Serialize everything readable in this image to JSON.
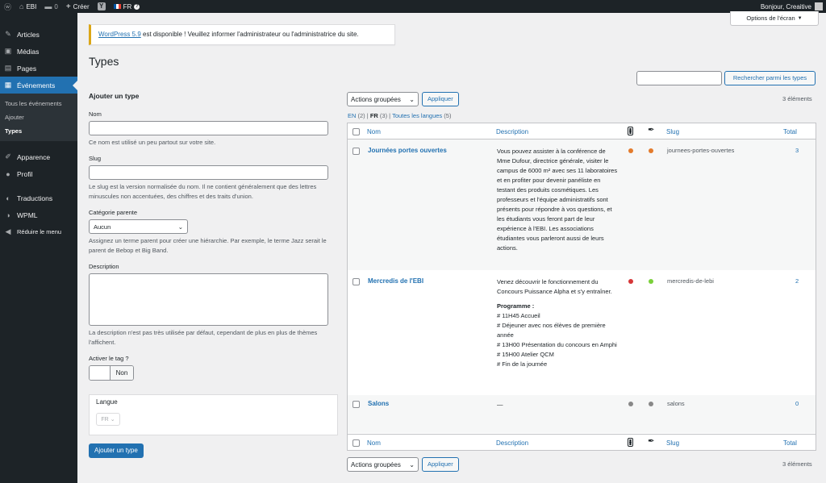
{
  "adminbar": {
    "site_name": "EBI",
    "comments_count": "0",
    "new_label": "Créer",
    "language": "FR",
    "greeting": "Bonjour, Creaitive"
  },
  "sidebar": {
    "items": [
      {
        "label": "Articles",
        "icon": "pin-icon"
      },
      {
        "label": "Médias",
        "icon": "media-icon"
      },
      {
        "label": "Pages",
        "icon": "pages-icon"
      },
      {
        "label": "Événements",
        "icon": "calendar-icon"
      },
      {
        "label": "Apparence",
        "icon": "brush-icon"
      },
      {
        "label": "Profil",
        "icon": "user-icon"
      },
      {
        "label": "Traductions",
        "icon": "translation-icon"
      },
      {
        "label": "WPML",
        "icon": "wpml-icon"
      },
      {
        "label": "Réduire le menu",
        "icon": "collapse-icon"
      }
    ],
    "submenu": [
      "Tous les événements",
      "Ajouter",
      "Types"
    ]
  },
  "screen_options": "Options de l'écran",
  "notice": {
    "link": "WordPress 5.9",
    "text": " est disponible ! Veuillez informer l'administrateur ou l'administratrice du site."
  },
  "page_title": "Types",
  "search_button": "Rechercher parmi les types",
  "form": {
    "heading": "Ajouter un type",
    "name_label": "Nom",
    "name_desc": "Ce nom est utilisé un peu partout sur votre site.",
    "slug_label": "Slug",
    "slug_desc": "Le slug est la version normalisée du nom. Il ne contient généralement que des lettres minuscules non accentuées, des chiffres et des traits d'union.",
    "parent_label": "Catégorie parente",
    "parent_value": "Aucun",
    "parent_desc": "Assignez un terme parent pour créer une hiérarchie. Par exemple, le terme Jazz serait le parent de Bebop et Big Band.",
    "description_label": "Description",
    "description_desc": "La description n'est pas très utilisée par défaut, cependant de plus en plus de thèmes l'affichent.",
    "tag_label": "Activer le tag ?",
    "tag_value": "Non",
    "language_label": "Langue",
    "language_value": "FR",
    "submit": "Ajouter un type"
  },
  "list": {
    "bulk_label": "Actions groupées",
    "apply": "Appliquer",
    "count": "3 éléments",
    "lang_filter": {
      "en": "EN",
      "en_count": "(2)",
      "fr": "FR",
      "fr_count": "(3)",
      "all": "Toutes les langues",
      "all_count": "(5)"
    },
    "columns": {
      "name": "Nom",
      "description": "Description",
      "slug": "Slug",
      "total": "Total"
    },
    "rows": [
      {
        "name": "Journées portes ouvertes",
        "description": "Vous pouvez assister à la conférence de Mme Dufour, directrice générale, visiter le campus de 6000 m² avec ses 11 laboratoires et en profiter pour devenir panéliste en testant des produits cosmétiques. Les professeurs et l'équipe administratifs sont présents pour répondre à vos questions, et les étudiants vous feront part de leur expérience à l'EBI. Les associations étudiantes vous parleront aussi de leurs actions.",
        "status1_color": "#e37b2c",
        "status2_color": "#e37b2c",
        "slug": "journees-portes-ouvertes",
        "total": "3"
      },
      {
        "name": "Mercredis de l'EBI",
        "description": "Venez découvrir le fonctionnement du Concours Puissance Alpha et s'y entraîner.",
        "program_title": "Programme :",
        "program_lines": [
          "# 11H45 Accueil",
          "# Déjeuner avec nos élèves de première année",
          "# 13H00 Présentation du concours en Amphi",
          "# 15H00 Atelier QCM",
          "# Fin de la journée"
        ],
        "status1_color": "#d63638",
        "status2_color": "#7ad03a",
        "slug": "mercredis-de-lebi",
        "total": "2"
      },
      {
        "name": "Salons",
        "description": "—",
        "status1_color": "#888888",
        "status2_color": "#888888",
        "slug": "salons",
        "total": "0"
      }
    ]
  }
}
